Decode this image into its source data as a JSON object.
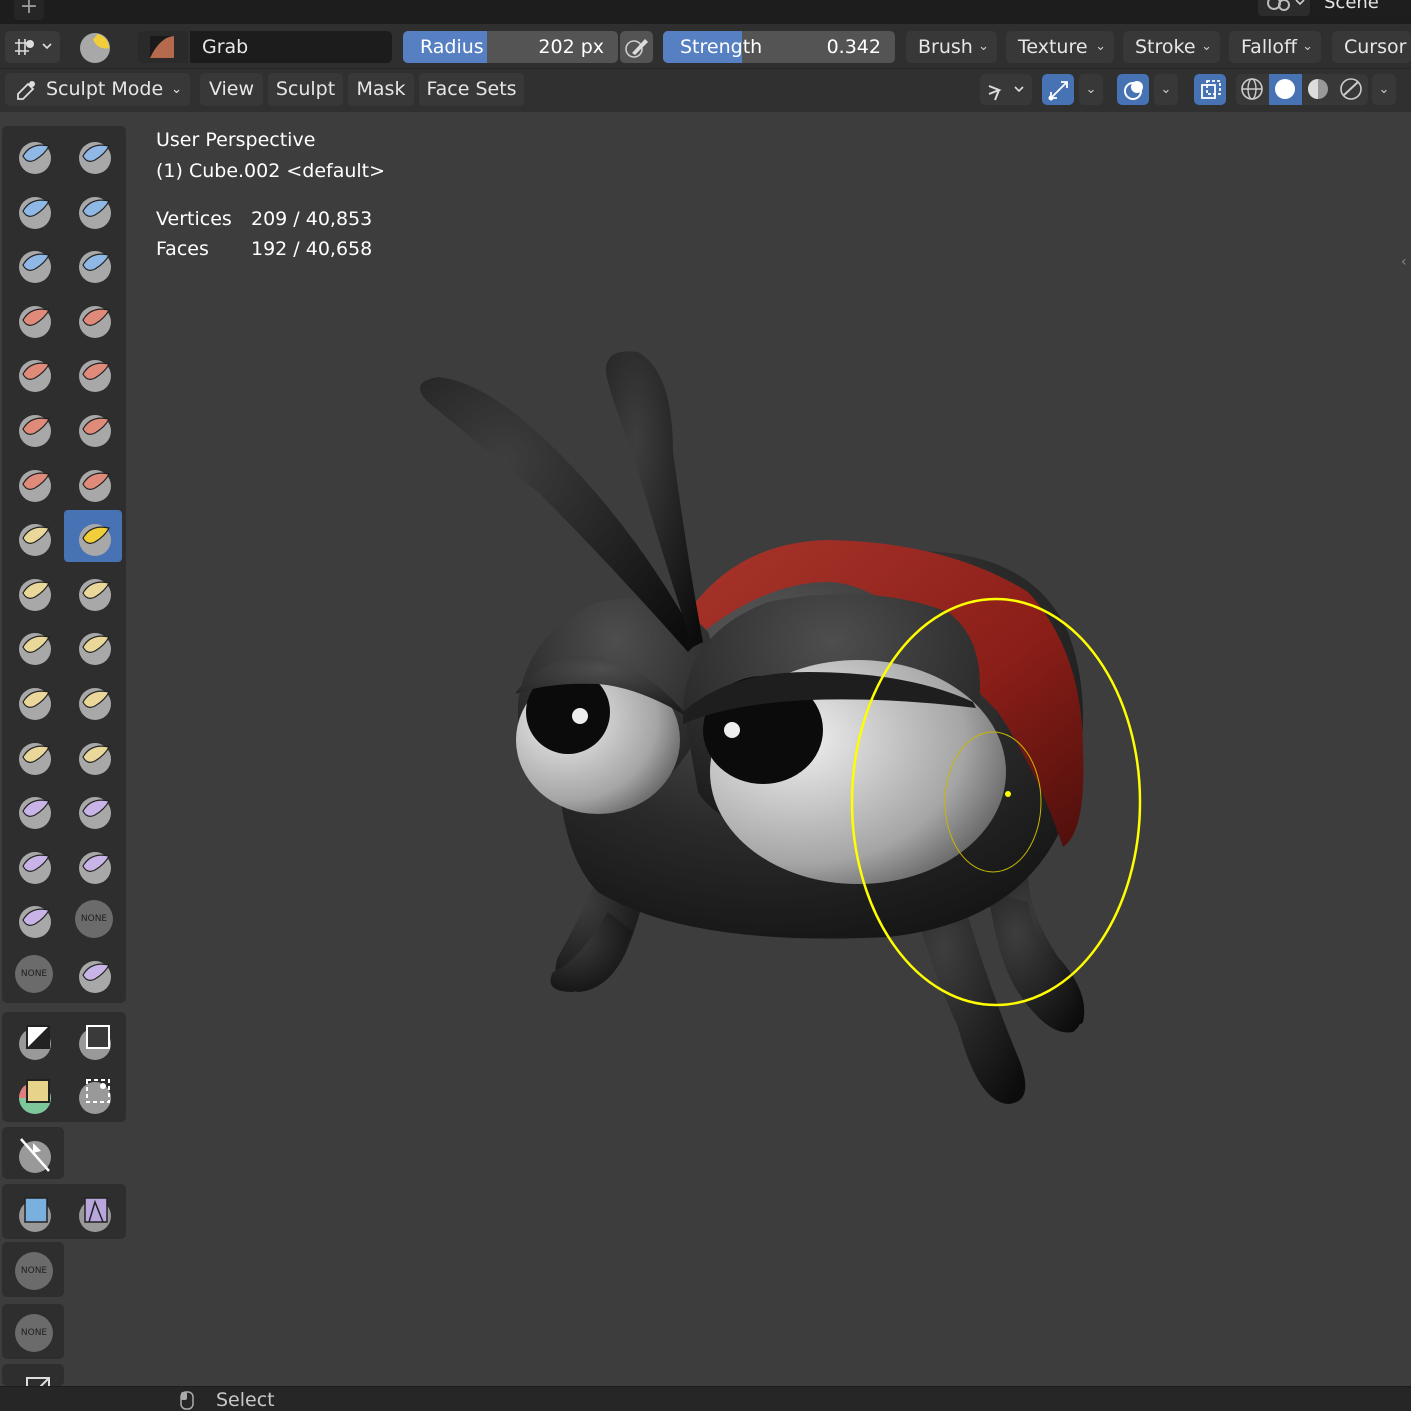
{
  "top": {
    "plus": "+",
    "scene": "Scene"
  },
  "tool_settings": {
    "brush_name": "Grab",
    "radius_label": "Radius",
    "radius_value": "202 px",
    "radius_fill": 0.39,
    "strength_label": "Strength",
    "strength_value": "0.342",
    "strength_fill": 0.342,
    "menus": [
      "Brush",
      "Texture",
      "Stroke",
      "Falloff",
      "Cursor"
    ]
  },
  "header": {
    "mode": "Sculpt Mode",
    "menus": [
      "View",
      "Sculpt",
      "Mask",
      "Face Sets"
    ]
  },
  "viewport": {
    "perspective": "User Perspective",
    "object": "(1) Cube.002 <default>",
    "vertices_label": "Vertices",
    "vertices_value": "209 / 40,853",
    "faces_label": "Faces",
    "faces_value": "192 / 40,658"
  },
  "toolbar": {
    "none_label": "NONE"
  },
  "status": {
    "select": "Select"
  },
  "colors": {
    "accent": "#4772b3",
    "slider_fill": "#5680c2",
    "brush_circle": "#ffff00",
    "shell_red": "#8b1e18"
  }
}
